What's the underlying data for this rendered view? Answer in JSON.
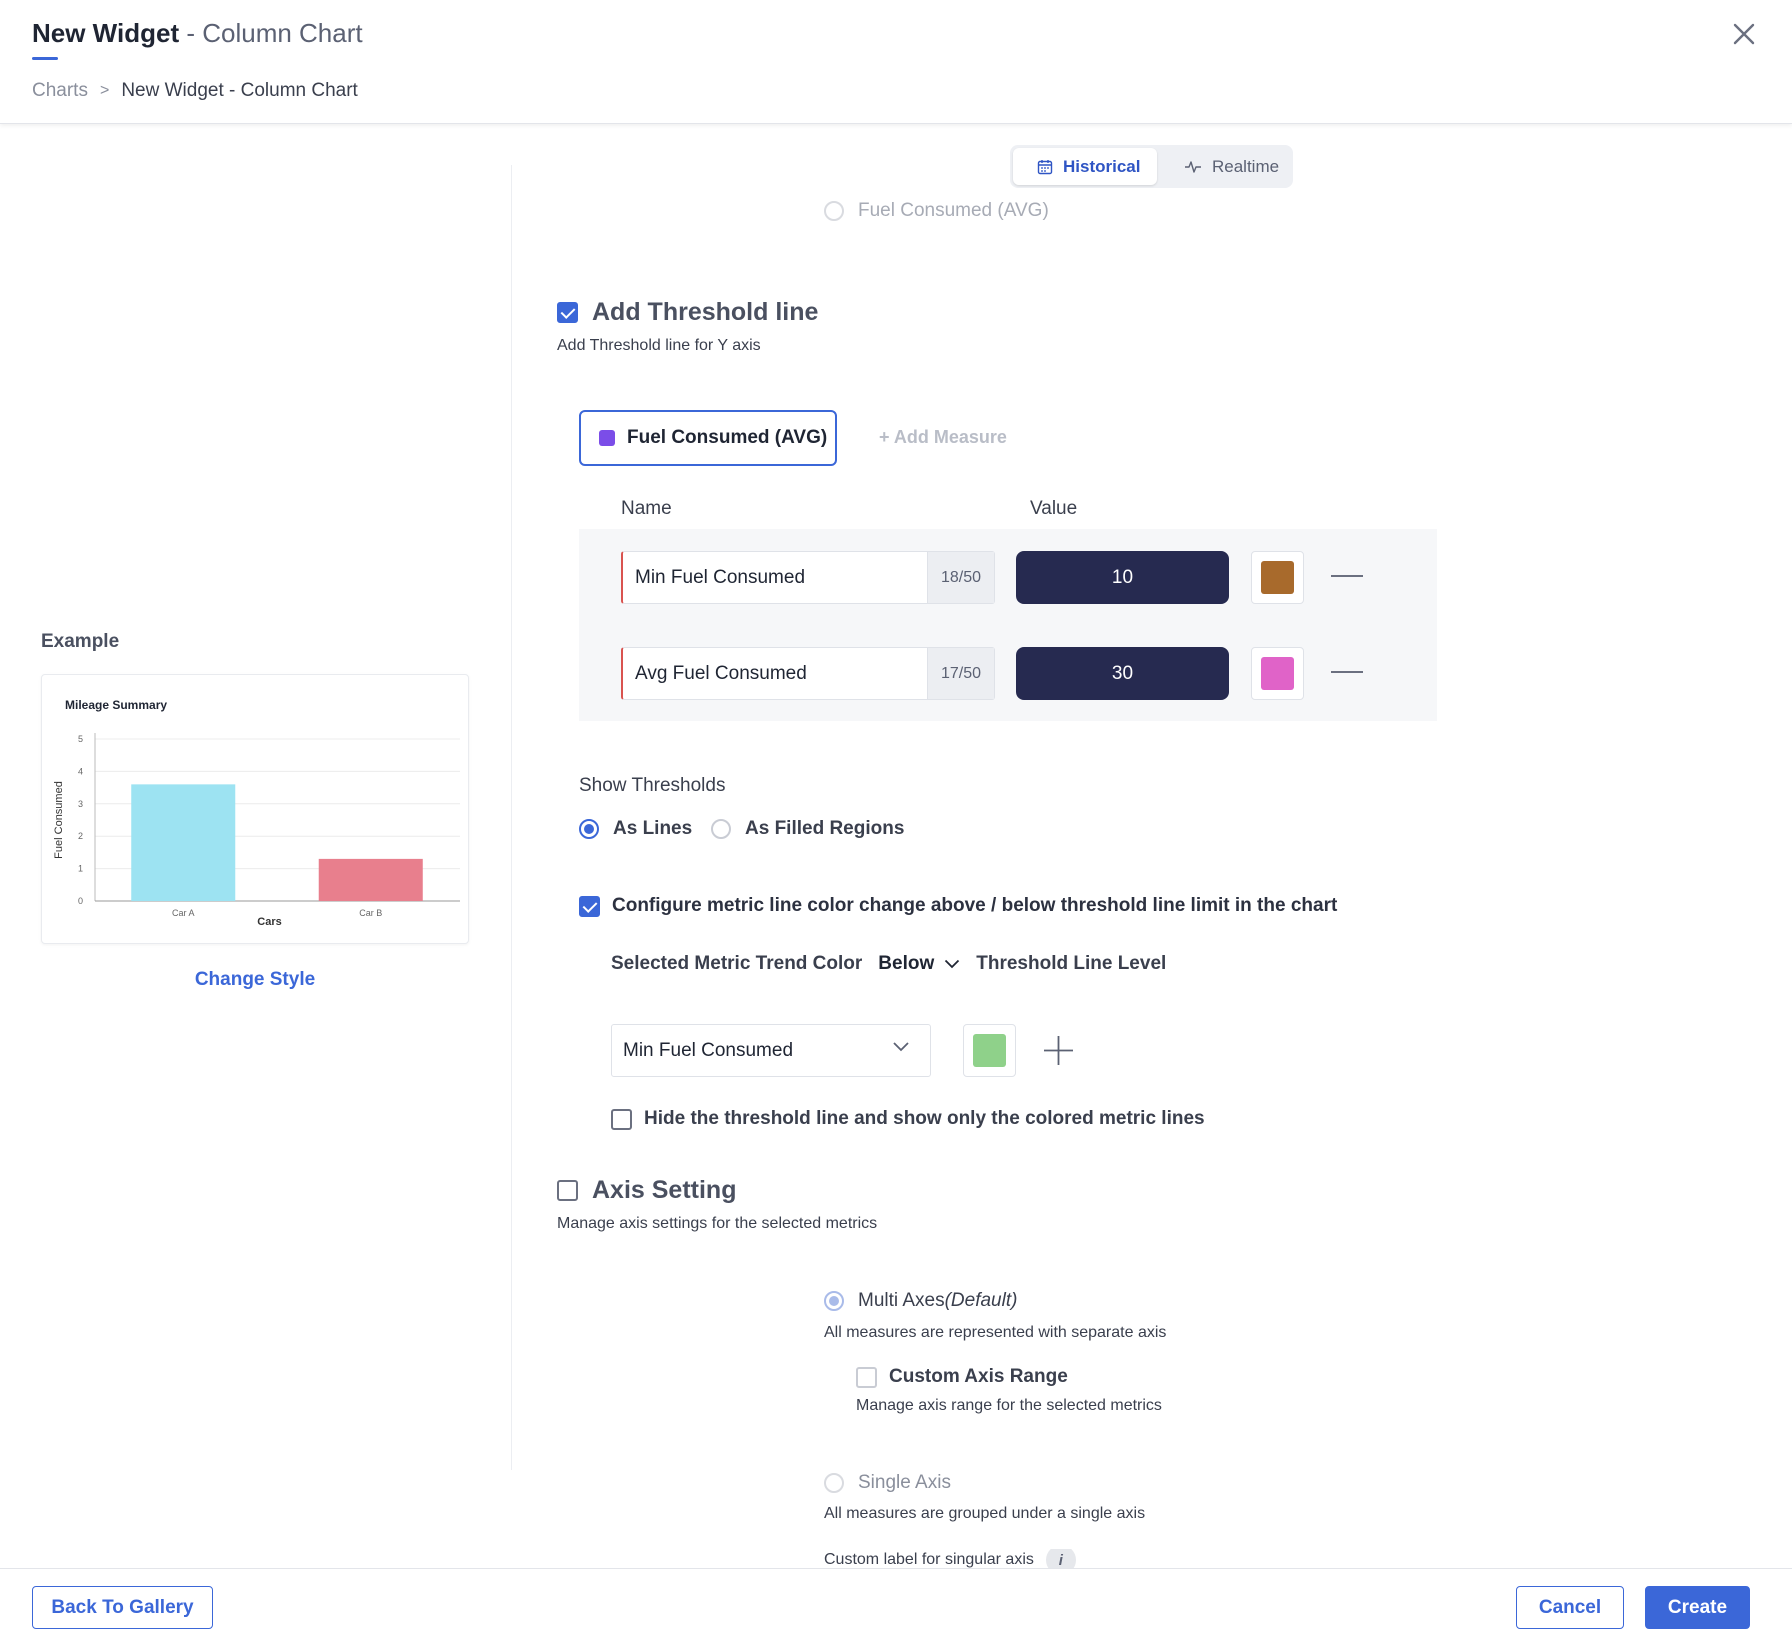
{
  "header": {
    "title_main": "New Widget",
    "title_sep": " - ",
    "title_sub": "Column Chart",
    "breadcrumb": {
      "root": "Charts",
      "sep": ">",
      "current": "New Widget - Column Chart"
    }
  },
  "mode_toggle": {
    "historical": "Historical",
    "realtime": "Realtime",
    "selected": "Historical"
  },
  "ghost_option": "Fuel Consumed (AVG)",
  "threshold": {
    "heading": "Add Threshold line",
    "subtitle": "Add Threshold line for Y axis",
    "checked": true,
    "measure_pill": "Fuel Consumed (AVG)",
    "measure_color": "#7b4de8",
    "add_measure": "+ Add Measure",
    "col_name": "Name",
    "col_value": "Value",
    "rows": [
      {
        "name": "Min Fuel Consumed",
        "count": "18/50",
        "value": "10",
        "color": "#a86a2c"
      },
      {
        "name": "Avg Fuel Consumed",
        "count": "17/50",
        "value": "30",
        "color": "#e063c8"
      }
    ],
    "show_thresholds_label": "Show Thresholds",
    "as_lines": "As Lines",
    "as_filled": "As Filled Regions",
    "configure_label": "Configure metric line color change above / below threshold line limit in the chart",
    "trend_label": "Selected Metric Trend Color",
    "trend_direction": "Below",
    "trend_suffix": "Threshold Line Level",
    "metric_select": "Min Fuel Consumed",
    "metric_color": "#8fd18a",
    "hide_label": "Hide the threshold line and show only the colored metric lines"
  },
  "axis": {
    "heading": "Axis Setting",
    "subtitle": "Manage axis settings for the selected metrics",
    "multi_label": "Multi Axes",
    "multi_default": "(Default)",
    "multi_desc": "All measures are represented with separate axis",
    "custom_range": "Custom Axis Range",
    "custom_range_desc": "Manage axis range for the selected metrics",
    "single_label": "Single Axis",
    "single_desc": "All measures are grouped under a single axis",
    "custom_label": "Custom label for singular axis",
    "info": "i"
  },
  "left": {
    "example_label": "Example",
    "change_style": "Change Style"
  },
  "chart_data": {
    "type": "bar",
    "title": "Mileage Summary",
    "xlabel": "Cars",
    "ylabel": "Fuel Consumed",
    "categories": [
      "Car A",
      "Car B"
    ],
    "values": [
      3.6,
      1.3
    ],
    "colors": [
      "#9de3f2",
      "#e87f8d"
    ],
    "ylim": [
      0,
      5
    ],
    "yticks": [
      "0",
      "1",
      "2",
      "3",
      "4",
      "5"
    ],
    "grid": true
  },
  "footer": {
    "back": "Back To Gallery",
    "cancel": "Cancel",
    "create": "Create"
  }
}
